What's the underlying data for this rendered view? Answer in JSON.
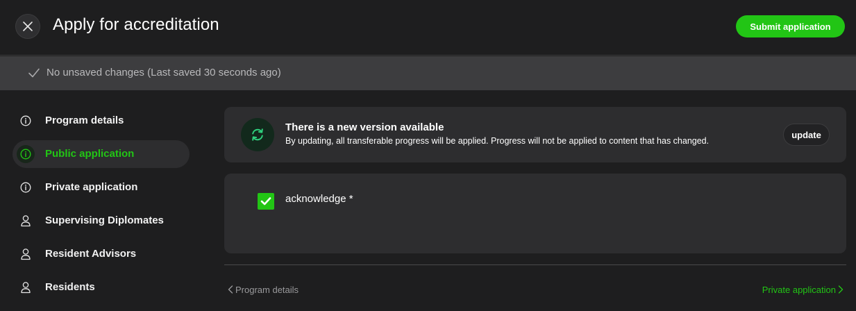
{
  "header": {
    "title": "Apply for accreditation",
    "close_icon": "close-icon",
    "submit_label": "Submit application"
  },
  "save_status": {
    "icon": "check-icon",
    "text": "No unsaved changes (Last saved 30 seconds ago)"
  },
  "sidebar": {
    "items": [
      {
        "label": "Program details",
        "icon": "info-icon",
        "active": false
      },
      {
        "label": "Public application",
        "icon": "info-icon",
        "active": true
      },
      {
        "label": "Private application",
        "icon": "info-icon",
        "active": false
      },
      {
        "label": "Supervising Diplomates",
        "icon": "person-icon",
        "active": false
      },
      {
        "label": "Resident Advisors",
        "icon": "person-icon",
        "active": false
      },
      {
        "label": "Residents",
        "icon": "person-icon",
        "active": false
      }
    ]
  },
  "update_notice": {
    "icon": "sync-icon",
    "title": "There is a new version available",
    "description": "By updating, all transferable progress will be applied. Progress will not be applied to content that has changed.",
    "button_label": "update"
  },
  "acknowledge": {
    "label": "acknowledge *",
    "checked": true
  },
  "footer_nav": {
    "prev_label": "Program details",
    "next_label": "Private application"
  },
  "colors": {
    "accent": "#22c515",
    "background": "#1e1e1f",
    "card": "#2d2d2f",
    "savebar": "#3d3d3f"
  }
}
